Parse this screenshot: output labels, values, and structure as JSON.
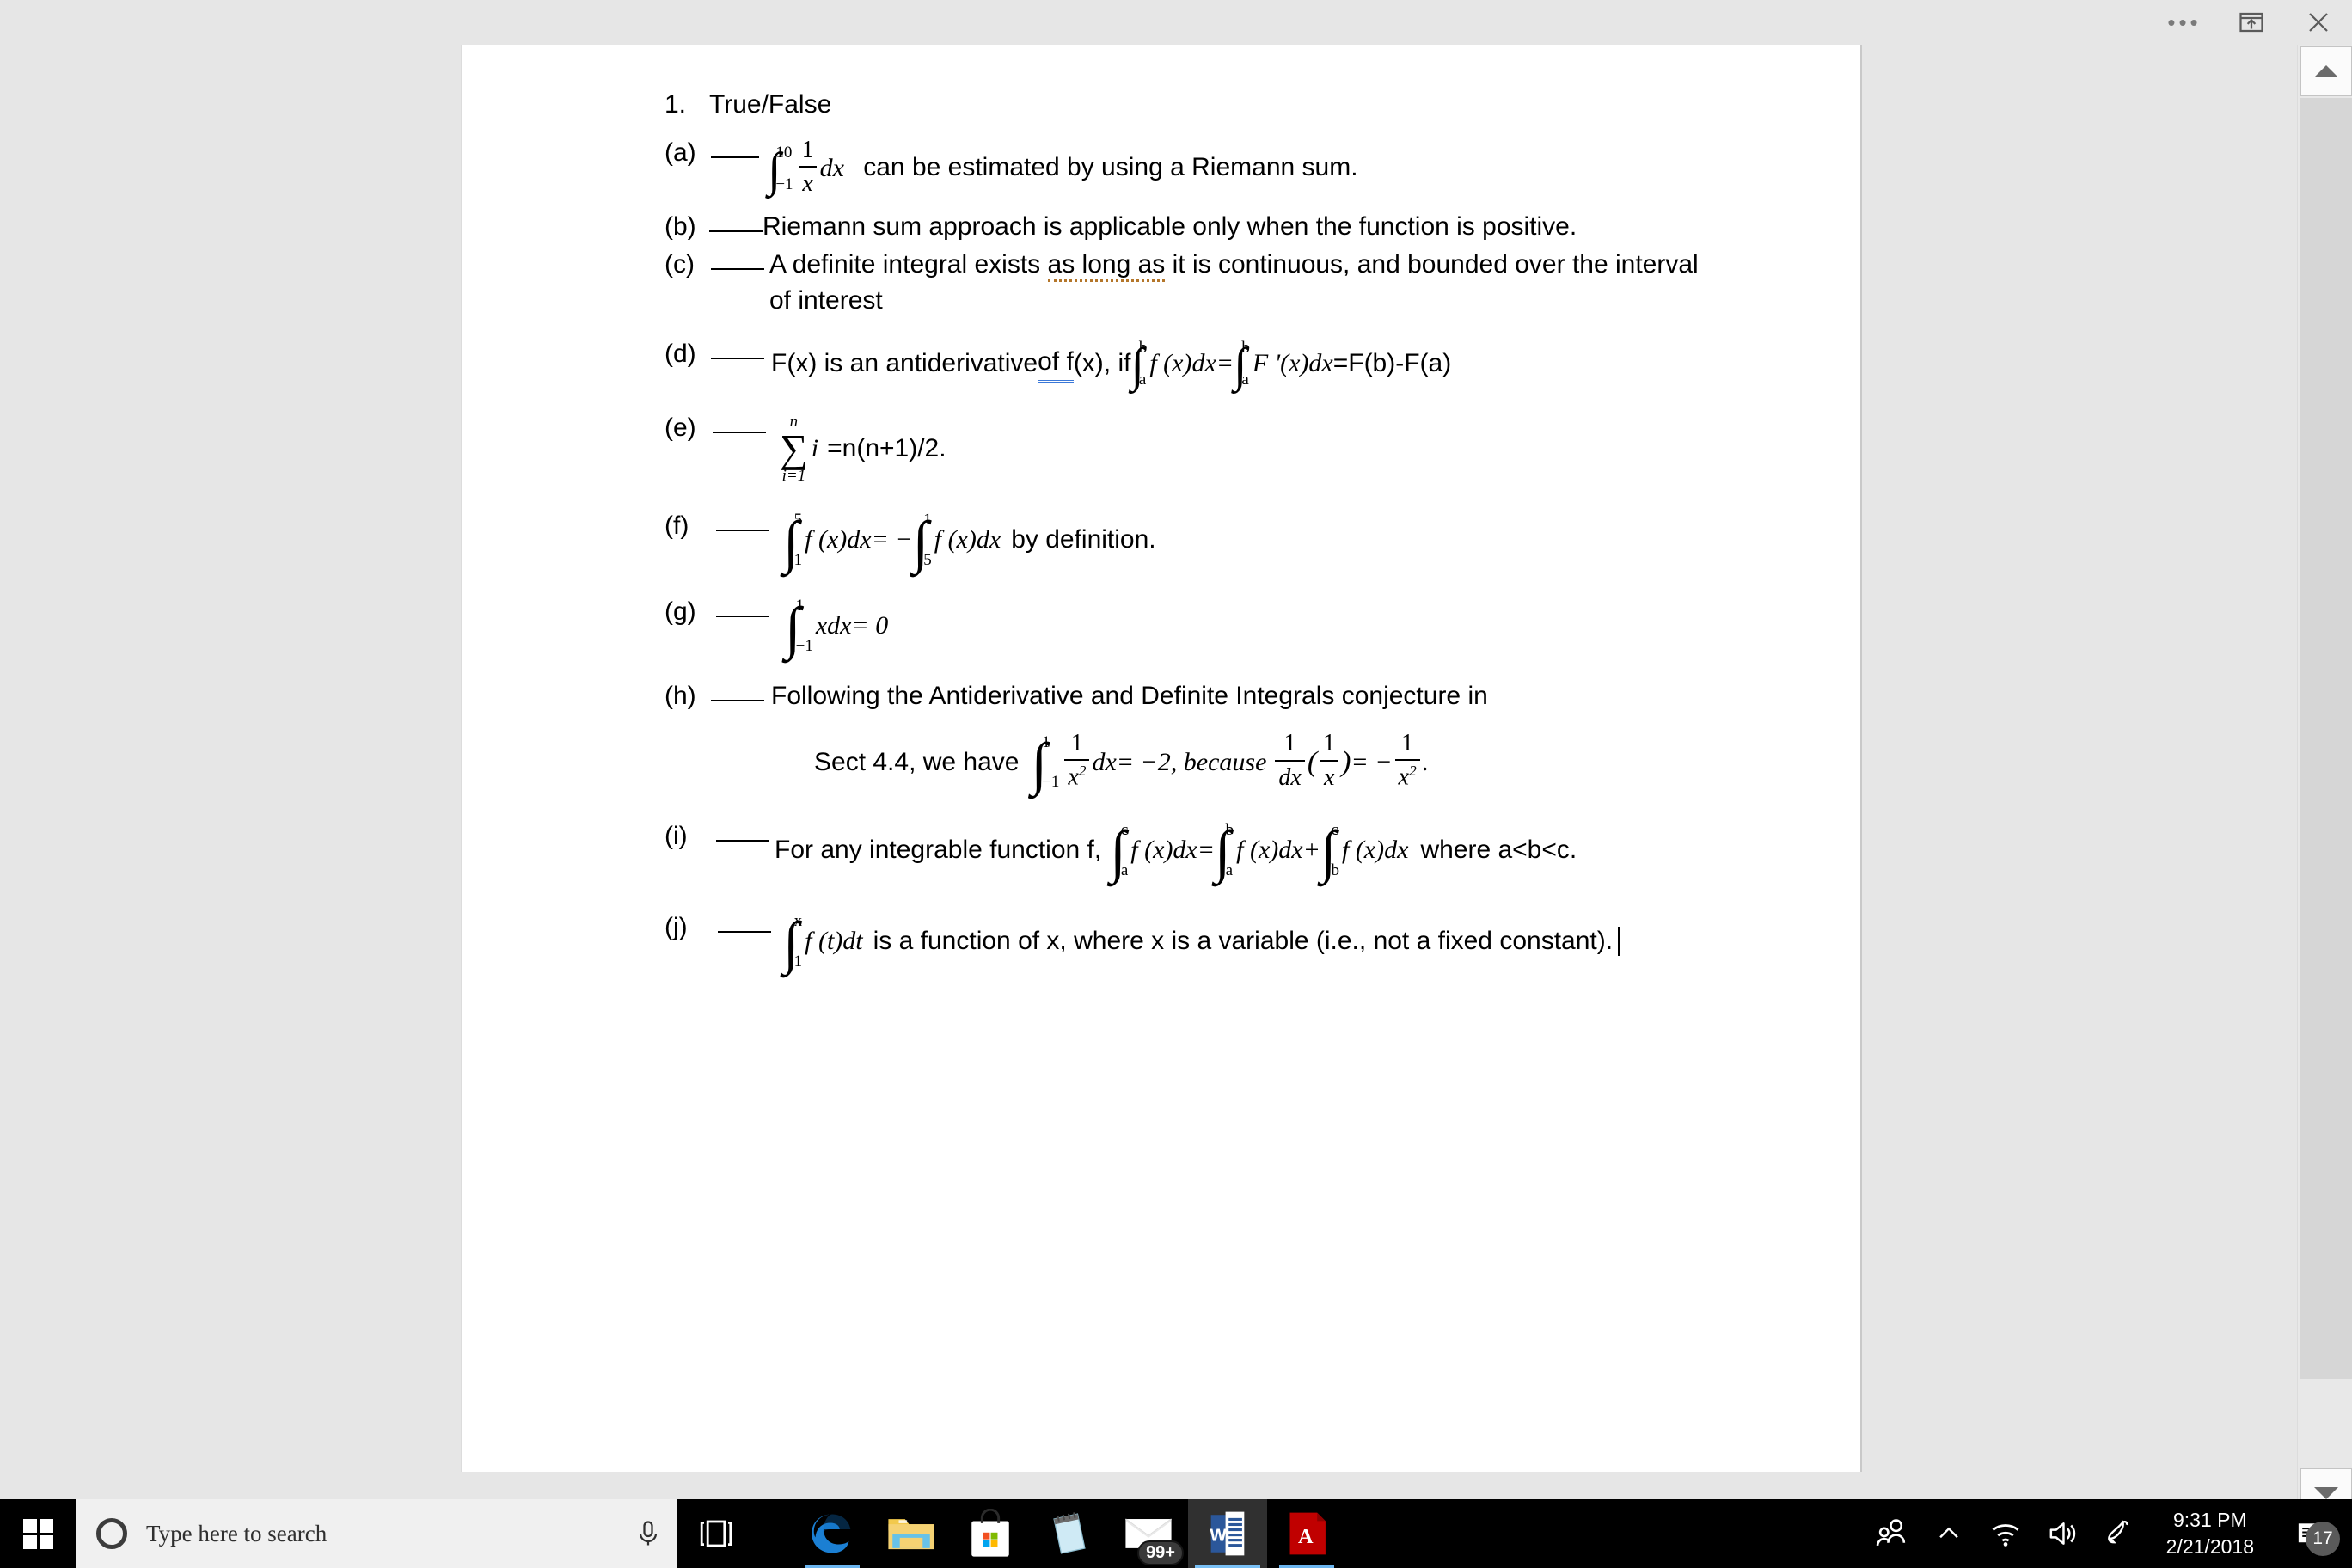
{
  "titlebar": {
    "more_label": "•••",
    "share_icon": "share-export-icon",
    "close_label": "✕"
  },
  "document": {
    "question_number": "1.",
    "question_title": "True/False",
    "items": [
      {
        "label": "(a)",
        "math_lower": "−1",
        "math_upper": "10",
        "frac_num": "1",
        "frac_den": "x",
        "math_dx": "dx",
        "text": "can be estimated by using a Riemann sum."
      },
      {
        "label": "(b)",
        "text": "Riemann sum approach is applicable only when the function is positive."
      },
      {
        "label": "(c)",
        "text_1": "A definite integral exists ",
        "text_spell": "as long as",
        "text_2": " it is continuous, and bounded over the interval",
        "text_line2": "of interest"
      },
      {
        "label": "(d)",
        "text_1": "F(x) is an antiderivative ",
        "text_gram": "of f",
        "text_2": "(x), if ",
        "int1_lo": "a",
        "int1_hi": "b",
        "int1_body": "f (x)dx",
        "eq1": " = ",
        "int2_lo": "a",
        "int2_hi": "b",
        "int2_body": "F '(x)dx",
        "tail": " =F(b)-F(a)"
      },
      {
        "label": "(e)",
        "sum_upper": "n",
        "sum_symbol": "∑",
        "sum_lower": "i=1",
        "sum_body": "i",
        "text": "=n(n+1)/2."
      },
      {
        "label": "(f)",
        "int1_lo": "1",
        "int1_hi": "5",
        "int1_body": "f (x)dx",
        "eq": " = −",
        "int2_lo": "5",
        "int2_hi": "1",
        "int2_body": "f (x)dx",
        "text": "by definition."
      },
      {
        "label": "(g)",
        "int_lo": "−1",
        "int_hi": "1",
        "int_body": "xdx",
        "text": " = 0"
      },
      {
        "label": "(h)",
        "text_1": "Following the Antiderivative and Definite Integrals conjecture in",
        "line2_pre": "Sect 4.4, we have",
        "int_lo": "−1",
        "int_hi": "1",
        "frac_num": "1",
        "frac_den": "x",
        "frac_den_sup": "2",
        "int_dx": "dx",
        "line2_mid": " = −2,  because",
        "frac2_num": "1",
        "frac2_den": "dx",
        "paren_open": "(",
        "frac3_num": "1",
        "frac3_den": "x",
        "paren_close": ")",
        "eq2": " = −",
        "frac4_num": "1",
        "frac4_den": "x",
        "frac4_den_sup": "2",
        "period": "."
      },
      {
        "label": "(i)",
        "text_1": "For any integrable function f,",
        "int1_lo": "a",
        "int1_hi": "c",
        "int1_body": "f (x)dx",
        "eq1": " = ",
        "int2_lo": "a",
        "int2_hi": "b",
        "int2_body": "f (x)dx",
        "eq2": " + ",
        "int3_lo": "b",
        "int3_hi": "c",
        "int3_body": "f (x)dx",
        "tail": "where a<b<c."
      },
      {
        "label": "(j)",
        "int_lo": "1",
        "int_hi": "x",
        "int_body": "f (t)dt",
        "text": "is a function of x, where x is a variable (i.e., not a fixed constant)."
      }
    ]
  },
  "scrollbar": {
    "up_arrow": "scroll-up-arrow",
    "down_arrow": "scroll-down-arrow"
  },
  "taskbar": {
    "start_label": "Start",
    "search_placeholder": "Type here to search",
    "cortana_icon": "cortana-circle-icon",
    "microphone_icon": "microphone-icon",
    "taskview_icon": "task-view-icon",
    "apps": [
      {
        "name": "microsoft-edge",
        "glyph": "e",
        "badge": null,
        "active": false,
        "open": true
      },
      {
        "name": "file-explorer",
        "glyph": "",
        "badge": null,
        "active": false,
        "open": false
      },
      {
        "name": "microsoft-store",
        "glyph": "",
        "badge": null,
        "active": false,
        "open": false
      },
      {
        "name": "sticky-notes",
        "glyph": "",
        "badge": null,
        "active": false,
        "open": false
      },
      {
        "name": "mail",
        "glyph": "",
        "badge": "99+",
        "active": false,
        "open": false
      },
      {
        "name": "microsoft-word",
        "glyph": "W",
        "badge": null,
        "active": true,
        "open": true
      },
      {
        "name": "adobe-acrobat",
        "glyph": "A",
        "badge": null,
        "active": false,
        "open": true
      }
    ],
    "tray": {
      "people_icon": "people-icon",
      "show_hidden_icon": "chevron-up-icon",
      "wifi_icon": "wifi-icon",
      "volume_icon": "volume-icon",
      "pen_icon": "windows-ink-icon",
      "time": "9:31 PM",
      "date": "2/21/2018",
      "notification_icon": "action-center-icon",
      "notification_count": "17"
    }
  },
  "colors": {
    "taskbar_bg": "#000000",
    "page_bg": "#ffffff",
    "canvas_bg": "#e6e6e6",
    "accent_blue": "#6cb6f0",
    "spell_underline": "#b4762a",
    "grammar_underline": "#3b78d8"
  }
}
